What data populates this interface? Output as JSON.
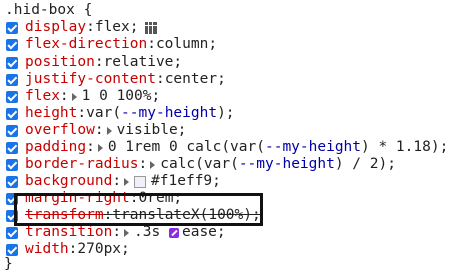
{
  "rule": {
    "selector": ".hid-box {",
    "closing": "}"
  },
  "declarations": [
    {
      "prop": "display",
      "value": "flex;",
      "has_flex_icon": true
    },
    {
      "prop": "flex-direction",
      "value": "column;"
    },
    {
      "prop": "position",
      "value": "relative;"
    },
    {
      "prop": "justify-content",
      "value": "center;"
    },
    {
      "prop": "flex",
      "value": "1 0 100%;",
      "has_expander": true
    },
    {
      "prop": "height",
      "value_parts": [
        "var(",
        "--my-height",
        ");"
      ]
    },
    {
      "prop": "overflow",
      "value": "visible;",
      "has_expander": true
    },
    {
      "prop": "padding",
      "value_parts": [
        "0 1rem 0 calc(var(",
        "--my-height",
        ") * 1.18);"
      ],
      "has_expander": true
    },
    {
      "prop": "border-radius",
      "value_parts": [
        "calc(var(",
        "--my-height",
        ") / 2);"
      ],
      "has_expander": true
    },
    {
      "prop": "background",
      "value": "#f1eff9;",
      "has_expander": true,
      "swatch_color": "#f1eff9"
    },
    {
      "prop": "margin-right",
      "value": "0rem;",
      "struck": false,
      "partially_hidden": true
    },
    {
      "prop": "transform",
      "value": "translateX(100%);",
      "struck": true
    },
    {
      "prop": "transition",
      "value": ".3s",
      "value_after": "ease;",
      "has_expander": true,
      "has_easing_icon": true
    },
    {
      "prop": "width",
      "value": "270px;"
    }
  ],
  "colors": {
    "checkbox": "#1a73e8",
    "property": "#c80000",
    "variable": "#0000aa",
    "highlight_box": "#111111"
  }
}
